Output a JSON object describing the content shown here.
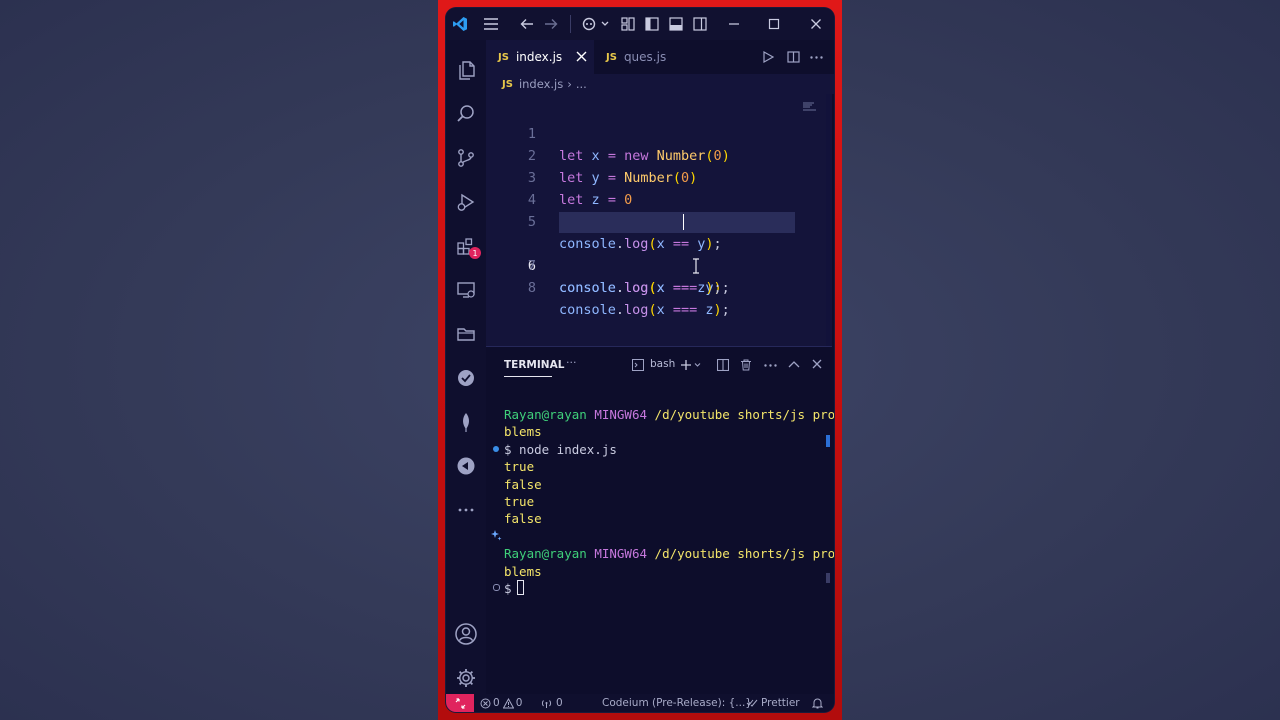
{
  "window": {
    "active_tab": "index.js",
    "inactive_tab": "ques.js",
    "tab_lang_badge": "JS",
    "breadcrumb_file": "index.js",
    "breadcrumb_sep": "›",
    "breadcrumb_more": "...",
    "extensions_badge": "1"
  },
  "editor": {
    "lines": [
      {
        "n": "1"
      },
      {
        "n": "2"
      },
      {
        "n": "3"
      },
      {
        "n": "4"
      },
      {
        "n": "5"
      },
      {
        "n": "6"
      },
      {
        "n": "7"
      },
      {
        "n": "8"
      }
    ],
    "current_line": 6
  },
  "panel": {
    "tab_label": "TERMINAL",
    "shell_label": "bash",
    "more": "···"
  },
  "terminal": {
    "prompt_user": "Rayan@rayan",
    "prompt_env": "MINGW64",
    "prompt_path_1": "/d/youtube shorts/js pro",
    "prompt_path_2": "blems",
    "command": "$ node index.js",
    "outputs": [
      "true",
      "false",
      "true",
      "false"
    ],
    "prompt_path_3": "/d/youtube shorts/js pro",
    "prompt_path_4": "blems",
    "prompt_symbol": "$"
  },
  "status": {
    "errors": "0",
    "warnings": "0",
    "ports": "0",
    "codeium": "Codeium (Pre-Release): {...}",
    "prettier": "Prettier"
  },
  "colors": {
    "frame_red": "#d01414",
    "editor_bg": "#14143a",
    "terminal_bg": "#0d0d2b",
    "remote_badge": "#e0245e",
    "js_badge": "#e8c84a",
    "prompt_green": "#3fd07a",
    "prompt_magenta": "#c678dd",
    "path_yellow": "#f4e56a"
  }
}
